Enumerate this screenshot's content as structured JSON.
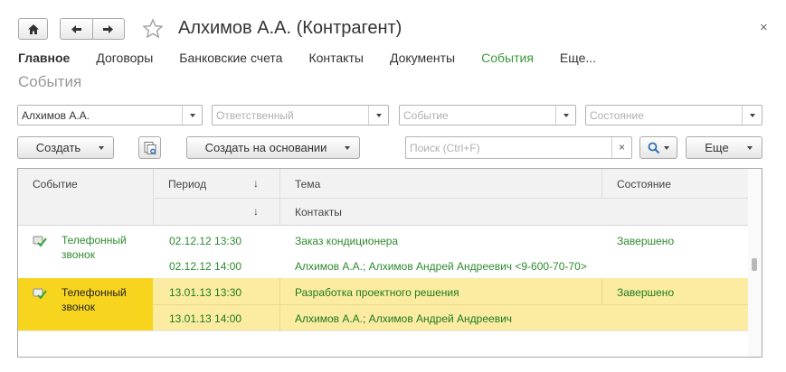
{
  "window": {
    "title": "Алхимов А.А. (Контрагент)",
    "close_glyph": "×"
  },
  "nav": {
    "tabs": [
      {
        "label": "Главное"
      },
      {
        "label": "Договоры"
      },
      {
        "label": "Банковские счета"
      },
      {
        "label": "Контакты"
      },
      {
        "label": "Документы"
      },
      {
        "label": "События"
      },
      {
        "label": "Еще..."
      }
    ]
  },
  "section_title": "События",
  "filters": {
    "counterparty": "Алхимов А.А.",
    "responsible_placeholder": "Ответственный",
    "event_placeholder": "Событие",
    "state_placeholder": "Состояние"
  },
  "toolbar": {
    "create_label": "Создать",
    "create_based_label": "Создать на основании",
    "search_placeholder": "Поиск (Ctrl+F)",
    "search_clear": "×",
    "more_label": "Еще"
  },
  "table": {
    "columns": {
      "event": "Событие",
      "period": "Период",
      "topic": "Тема",
      "state": "Состояние",
      "sort_arrow": "↓",
      "contacts": "Контакты"
    },
    "rows": [
      {
        "event_line1": "Телефонный",
        "event_line2": "звонок",
        "period": "02.12.12 13:30",
        "topic": "Заказ кондиционера",
        "state": "Завершено",
        "period2": "02.12.12 14:00",
        "contacts": "Алхимов А.А.; Алхимов Андрей Андреевич <9-600-70-70>"
      },
      {
        "event_line1": "Телефонный",
        "event_line2": "звонок",
        "period": "13.01.13 13:30",
        "topic": "Разработка проектного решения",
        "state": "Завершено",
        "period2": "13.01.13 14:00",
        "contacts": "Алхимов А.А.; Алхимов Андрей Андреевич"
      }
    ]
  },
  "colors": {
    "accent_green": "#3b9a3b",
    "selection_row": "#fbeca1",
    "selection_cell": "#f7d51f"
  }
}
